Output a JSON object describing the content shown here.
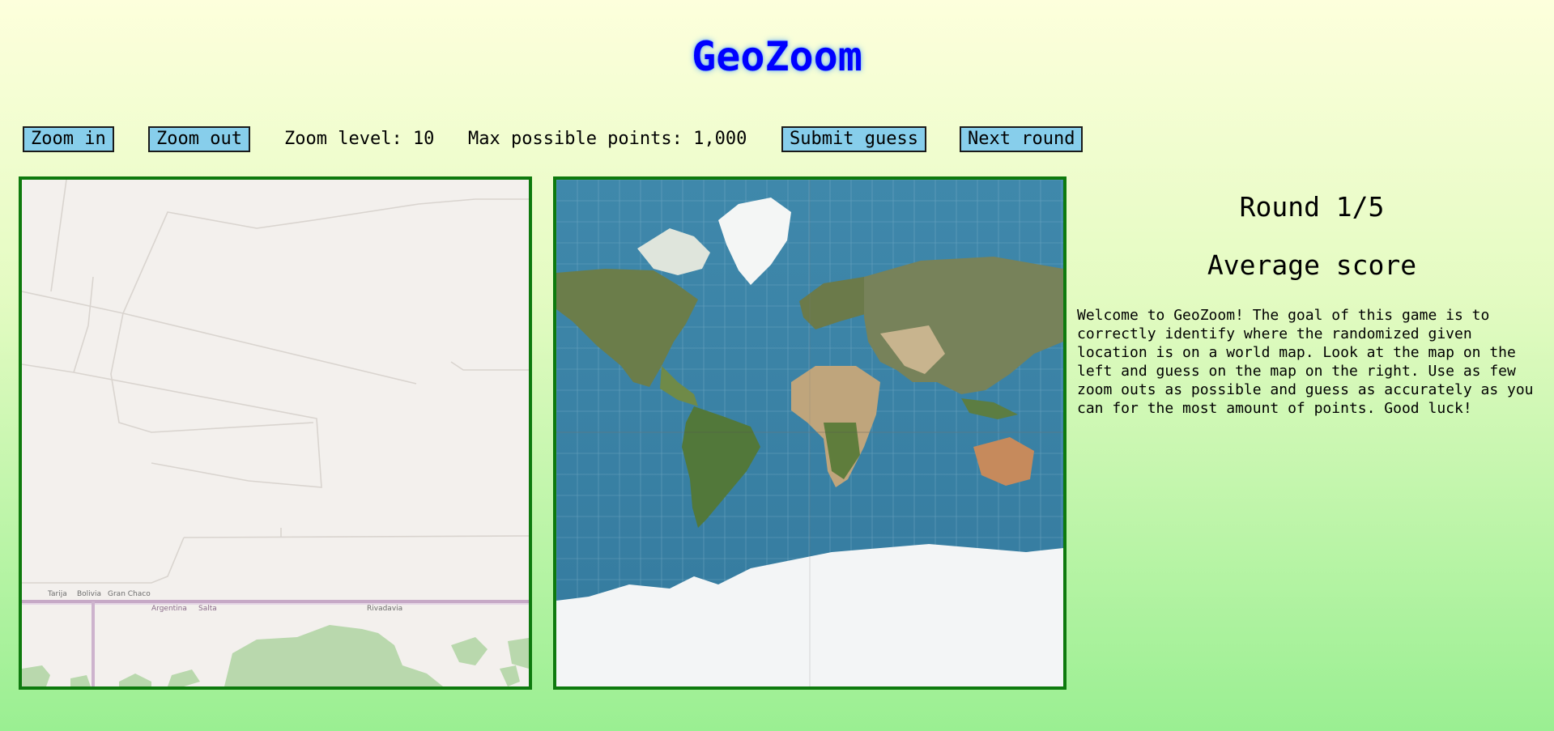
{
  "header": {
    "title": "GeoZoom"
  },
  "toolbar": {
    "zoom_in_label": "Zoom in",
    "zoom_out_label": "Zoom out",
    "zoom_level_text": "Zoom level: 10",
    "max_points_text": "Max possible points: 1,000",
    "submit_label": "Submit guess",
    "next_label": "Next round"
  },
  "street_map": {
    "labels": [
      "Tarija",
      "Bolivia",
      "Gran Chaco",
      "Argentina",
      "Salta",
      "Rivadavia"
    ]
  },
  "side": {
    "round_text": "Round 1/5",
    "average_text": "Average score",
    "welcome_text": "Welcome to GeoZoom! The goal of this game is to correctly identify where the randomized given location is on a world map. Look at the map on the left and guess on the map on the right. Use as few zoom outs as possible and guess as accurately as you can for the most amount of points. Good luck!"
  },
  "colors": {
    "title": "#0000ff",
    "button_bg": "#87ceeb",
    "map_border": "#0e7a0e",
    "ocean": "#3a85a9"
  }
}
